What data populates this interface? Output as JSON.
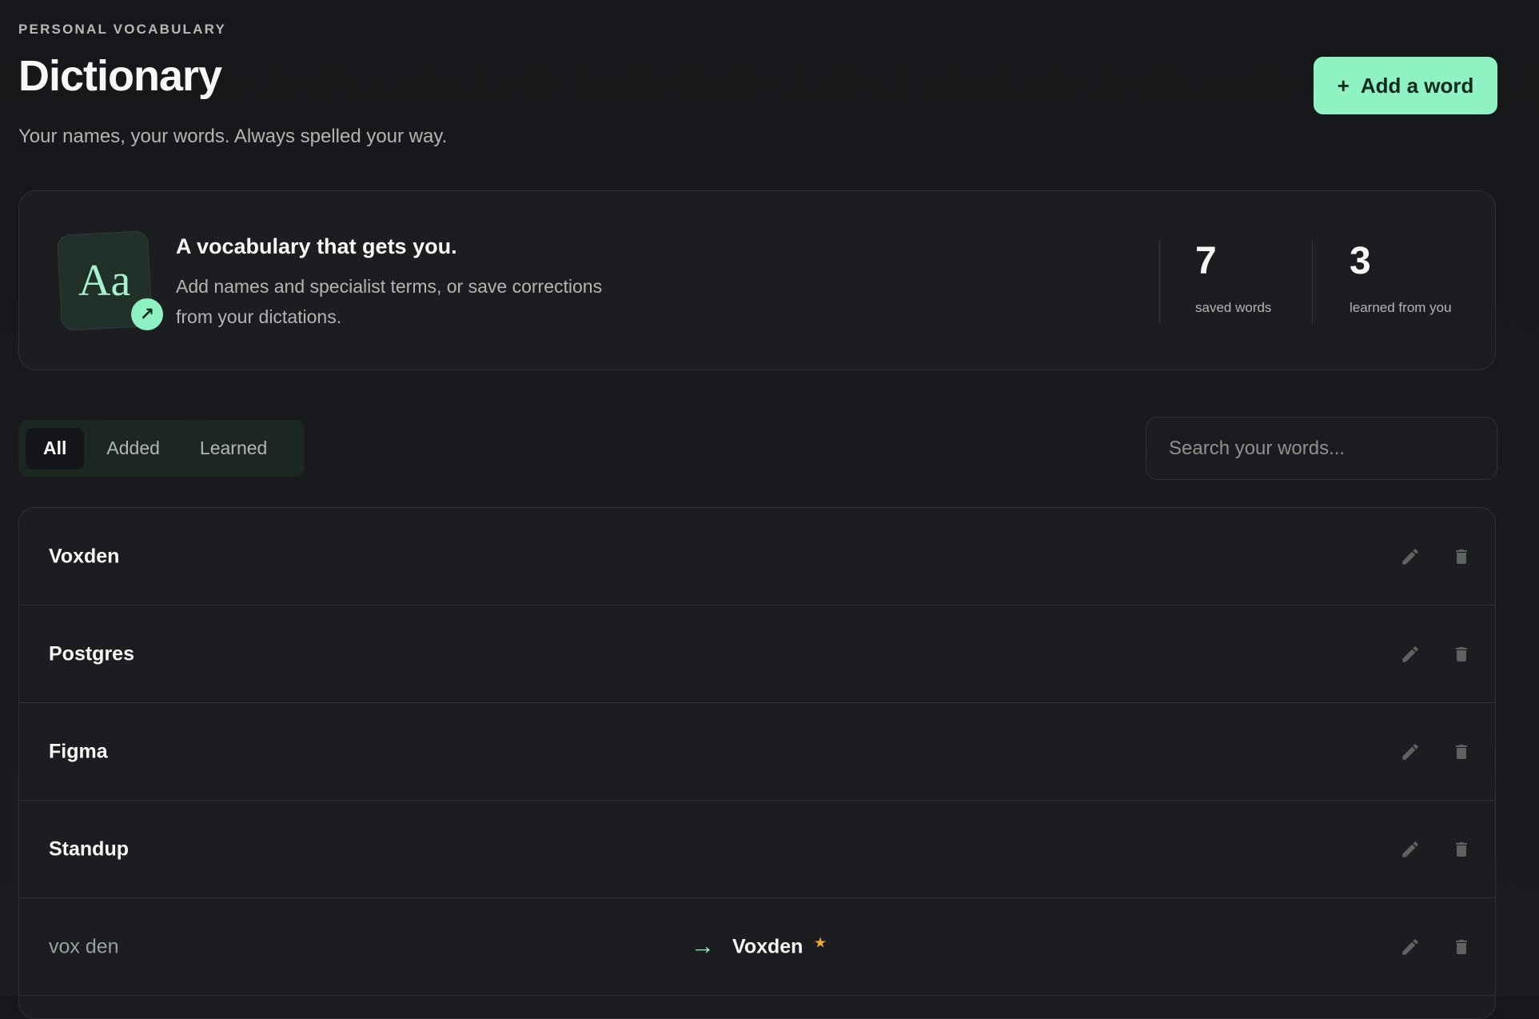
{
  "header": {
    "eyebrow": "PERSONAL VOCABULARY",
    "title": "Dictionary",
    "subtitle": "Your names, your words. Always spelled your way.",
    "add_button": {
      "icon": "+",
      "label": "Add a word"
    }
  },
  "hero": {
    "tile_glyph": "Aa",
    "badge_icon": "↗",
    "heading": "A vocabulary that gets you.",
    "body_line1": "Add names and specialist terms, or save corrections",
    "body_line2": "from your dictations.",
    "stats": [
      {
        "value": "7",
        "label": "saved words"
      },
      {
        "value": "3",
        "label": "learned from you"
      }
    ]
  },
  "filters": {
    "tabs": [
      "All",
      "Added",
      "Learned"
    ],
    "selected": "All"
  },
  "search": {
    "placeholder": "Search your words...",
    "value": ""
  },
  "words": [
    {
      "word": "Voxden"
    },
    {
      "word": "Postgres"
    },
    {
      "word": "Figma"
    },
    {
      "word": "Standup"
    },
    {
      "heard": "vox den",
      "arrow": "→",
      "replacement": "Voxden",
      "star": "★"
    }
  ],
  "colors": {
    "accent": "#8ef2c2",
    "star": "#f2a93b",
    "background": "#15171a",
    "card": "#1b1d21"
  }
}
